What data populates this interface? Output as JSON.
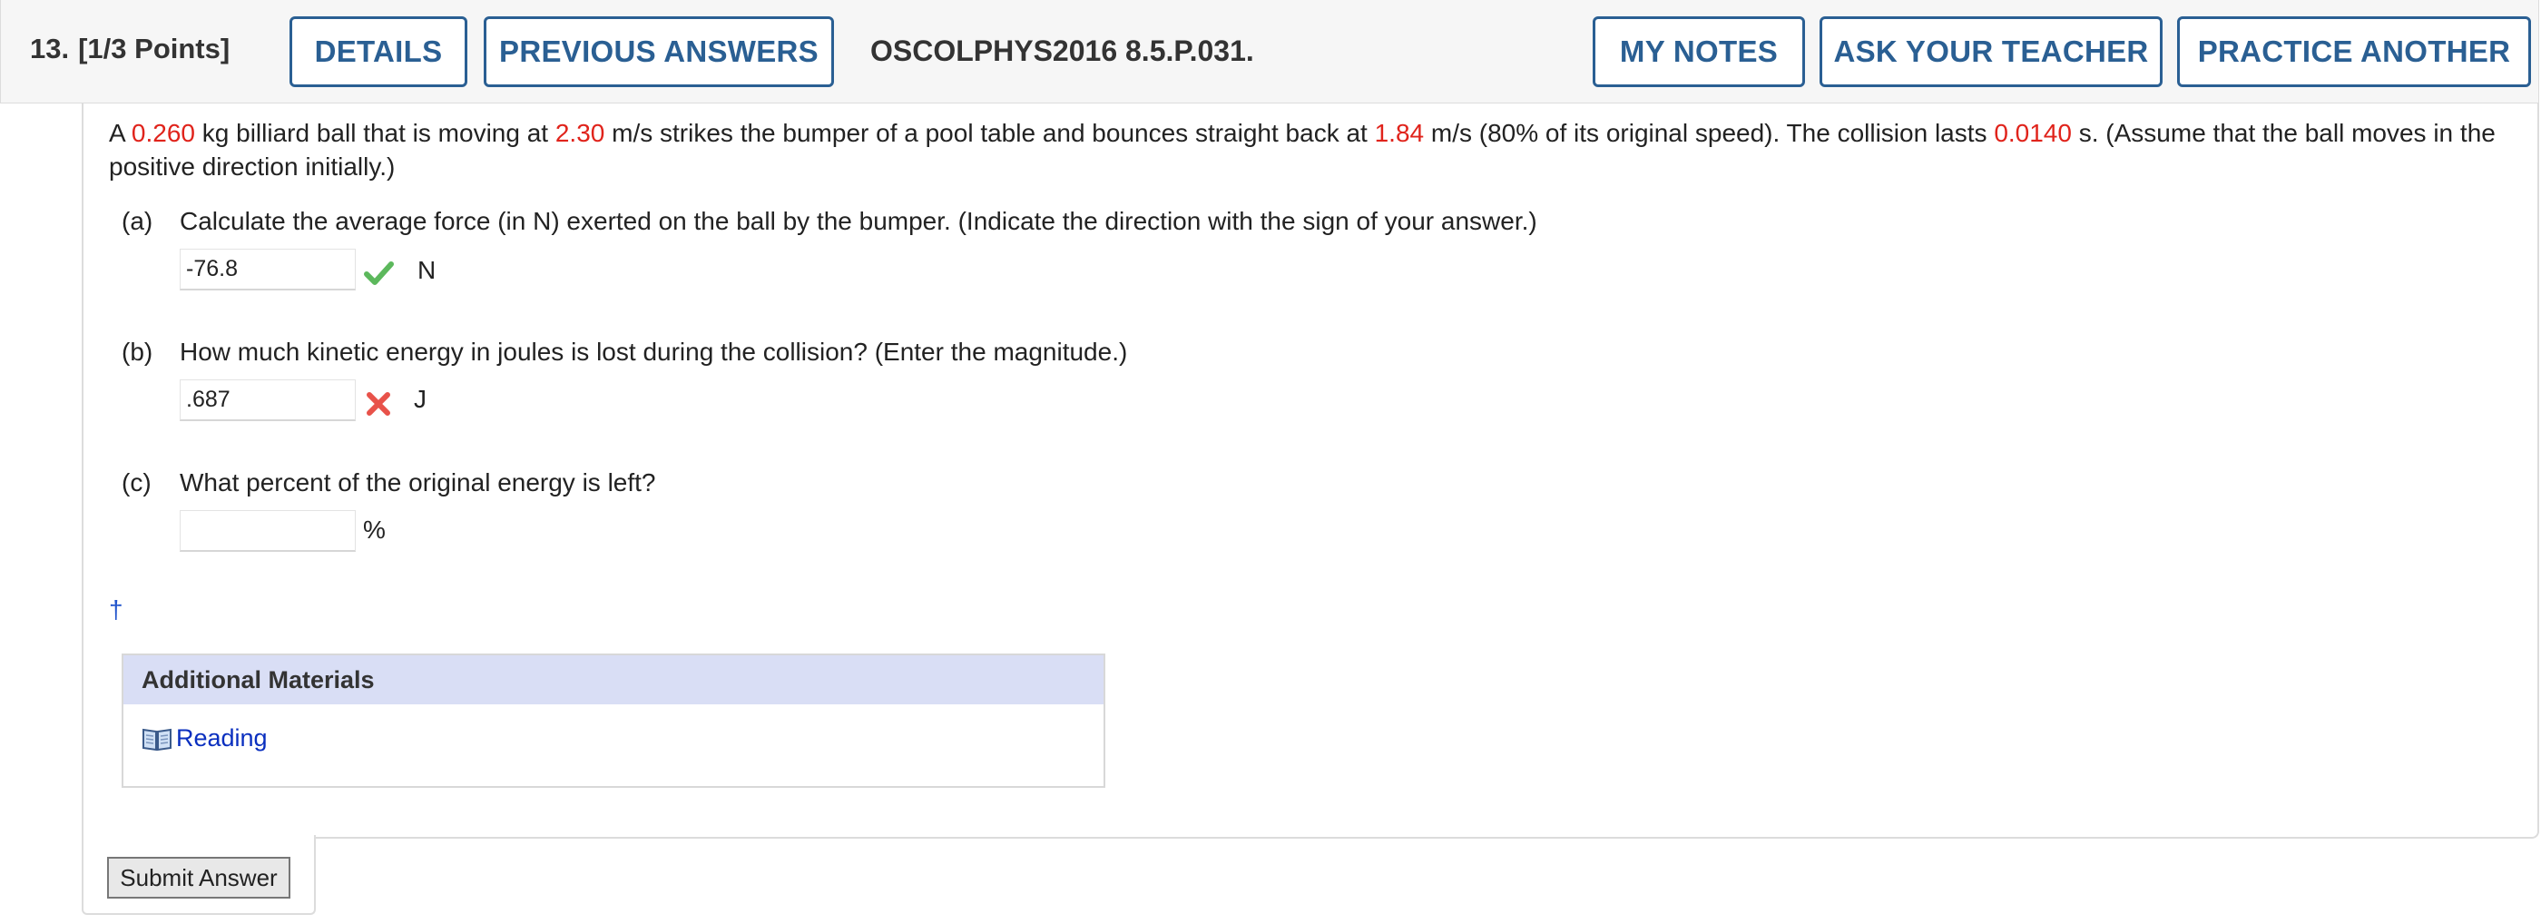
{
  "header": {
    "question_number": "13.",
    "points": "[1/3 Points]",
    "details_label": "DETAILS",
    "previous_answers_label": "PREVIOUS ANSWERS",
    "problem_code": "OSCOLPHYS2016 8.5.P.031.",
    "my_notes_label": "MY NOTES",
    "ask_teacher_label": "ASK YOUR TEACHER",
    "practice_another_label": "PRACTICE ANOTHER",
    "button_color": "#2a5f93"
  },
  "stem": {
    "t1": "A ",
    "mass": "0.260",
    "t2": " kg billiard ball that is moving at ",
    "v1": "2.30",
    "t3": " m/s strikes the bumper of a pool table and bounces straight back at ",
    "v2": "1.84",
    "t4": " m/s (80% of its original speed). The collision lasts ",
    "time": "0.0140",
    "t5": " s. (Assume that the ball moves in the positive direction initially.)",
    "highlight_color": "#e0231b"
  },
  "parts": {
    "a": {
      "label": "(a)",
      "question": "Calculate the average force (in N) exerted on the ball by the bumper. (Indicate the direction with the sign of your answer.)",
      "value": "-76.8",
      "status_icon": "checkmark-icon",
      "unit": "N"
    },
    "b": {
      "label": "(b)",
      "question": "How much kinetic energy in joules is lost during the collision? (Enter the magnitude.)",
      "value": ".687",
      "status_icon": "cross-icon",
      "unit": "J"
    },
    "c": {
      "label": "(c)",
      "question": "What percent of the original energy is left?",
      "value": "",
      "unit": "%"
    }
  },
  "footnote_symbol": "†",
  "materials": {
    "title": "Additional Materials",
    "reading_label": "Reading",
    "reading_icon": "book-icon"
  },
  "submit_label": "Submit Answer"
}
